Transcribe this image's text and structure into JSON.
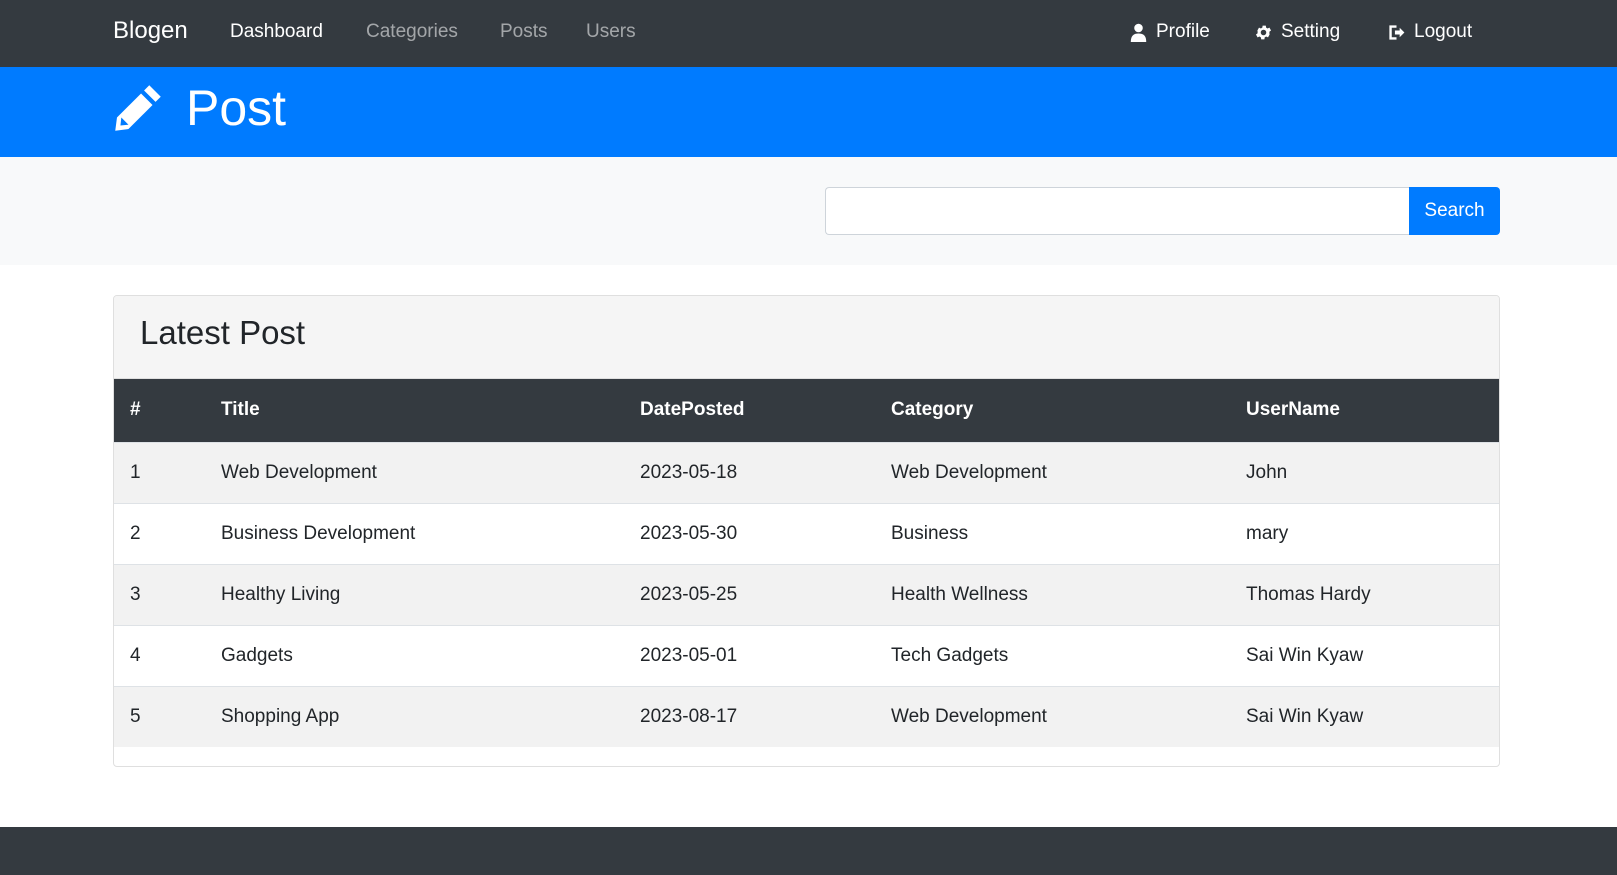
{
  "navbar": {
    "brand": "Blogen",
    "links": [
      "Dashboard",
      "Categories",
      "Posts",
      "Users"
    ],
    "active_link": "Dashboard",
    "right": {
      "profile": "Profile",
      "setting": "Setting",
      "logout": "Logout"
    },
    "icons": [
      "user-icon",
      "gear-icon",
      "logout-icon"
    ]
  },
  "header": {
    "icon": "pencil-icon",
    "title": "Post"
  },
  "search": {
    "value": "",
    "button": "Search"
  },
  "posts": {
    "title": "Latest Post",
    "columns": [
      "#",
      "Title",
      "DatePosted",
      "Category",
      "UserName"
    ],
    "rows": [
      [
        "1",
        "Web Development",
        "2023-05-18",
        "Web Development",
        "John"
      ],
      [
        "2",
        "Business Development",
        "2023-05-30",
        "Business",
        "mary"
      ],
      [
        "3",
        "Healthy Living",
        "2023-05-25",
        "Health Wellness",
        "Thomas Hardy"
      ],
      [
        "4",
        "Gadgets",
        "2023-05-01",
        "Tech Gadgets",
        "Sai Win Kyaw"
      ],
      [
        "5",
        "Shopping App",
        "2023-08-17",
        "Web Development",
        "Sai Win Kyaw"
      ]
    ]
  },
  "colors": {
    "navbar": "#343a40",
    "primary": "#007bff",
    "light": "#f8f9fa"
  }
}
